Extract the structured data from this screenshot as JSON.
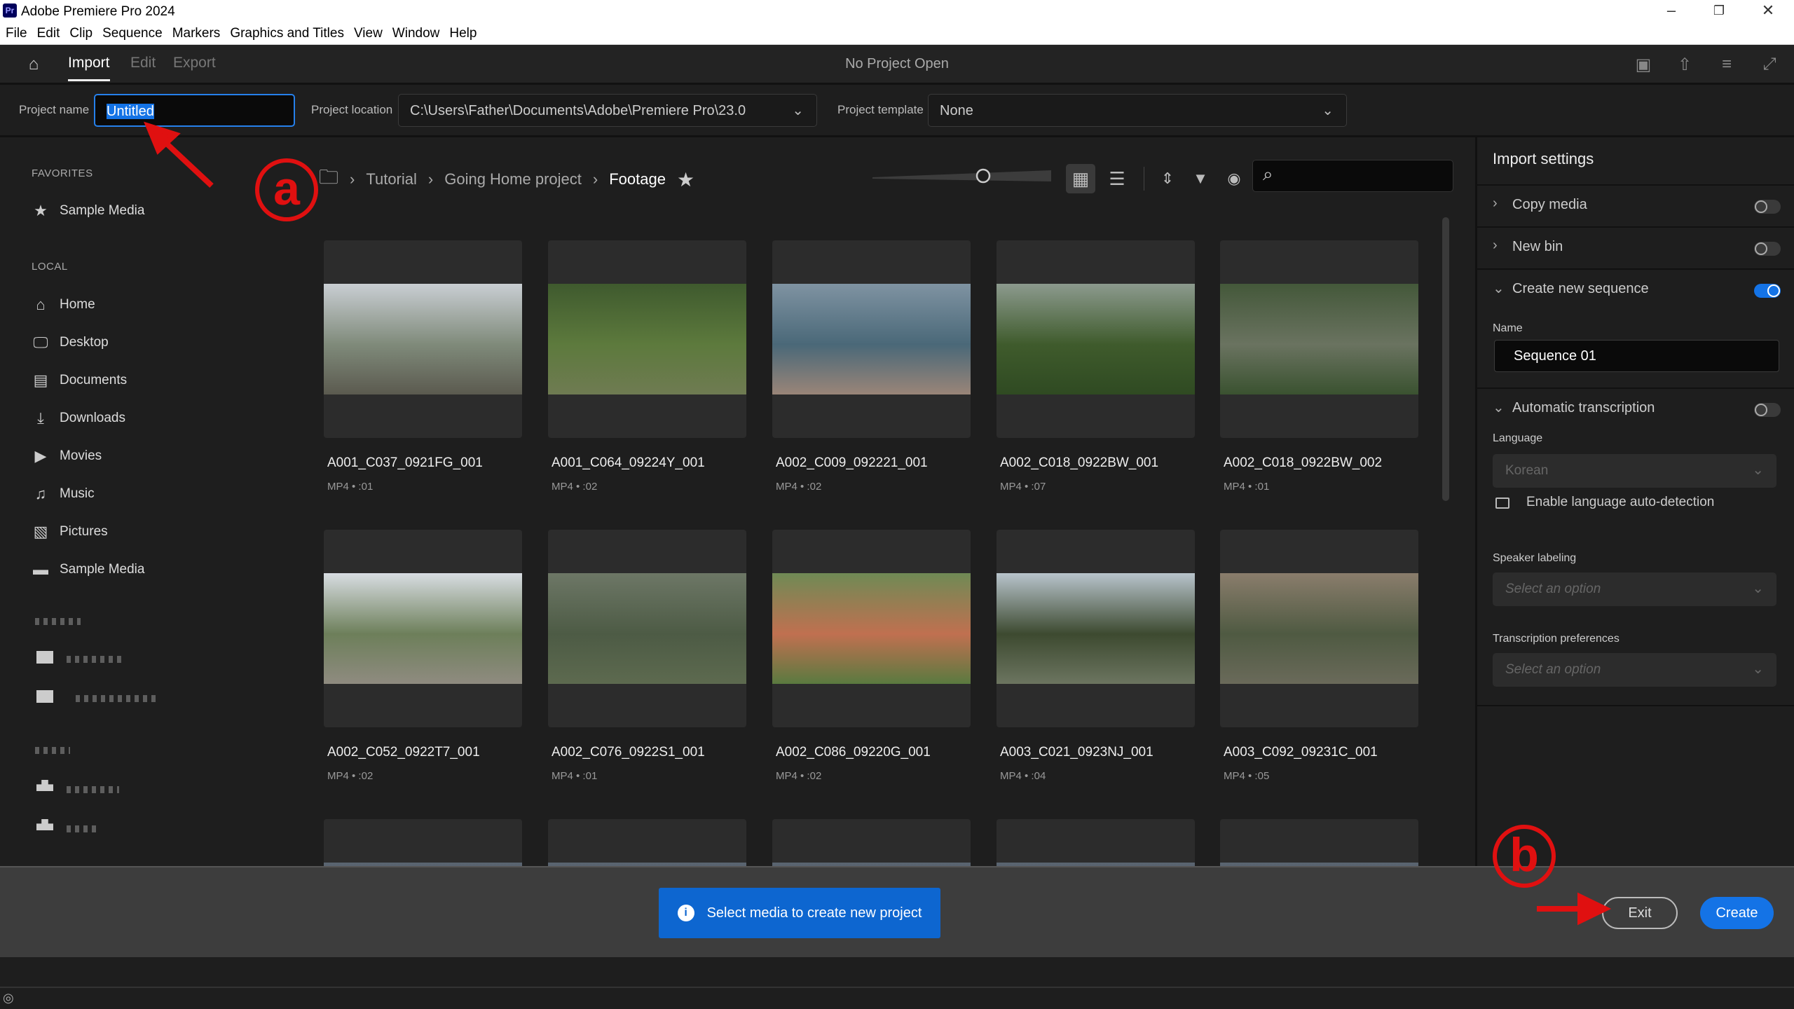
{
  "app": {
    "title": "Adobe Premiere Pro 2024",
    "logo": "Pr"
  },
  "menu": [
    "File",
    "Edit",
    "Clip",
    "Sequence",
    "Markers",
    "Graphics and Titles",
    "View",
    "Window",
    "Help"
  ],
  "nav": {
    "tabs": [
      "Import",
      "Edit",
      "Export"
    ],
    "active_tab": "Import",
    "status": "No Project Open"
  },
  "project": {
    "name_label": "Project name",
    "name_value": "Untitled",
    "location_label": "Project location",
    "location_value": "C:\\Users\\Father\\Documents\\Adobe\\Premiere Pro\\23.0",
    "template_label": "Project template",
    "template_value": "None"
  },
  "sidebar": {
    "favorites_label": "FAVORITES",
    "favorites": [
      {
        "label": "Sample Media",
        "icon": "star-icon"
      }
    ],
    "local_label": "LOCAL",
    "local": [
      {
        "label": "Home",
        "icon": "home-icon"
      },
      {
        "label": "Desktop",
        "icon": "desktop-icon"
      },
      {
        "label": "Documents",
        "icon": "document-icon"
      },
      {
        "label": "Downloads",
        "icon": "download-icon"
      },
      {
        "label": "Movies",
        "icon": "movie-icon"
      },
      {
        "label": "Music",
        "icon": "music-icon"
      },
      {
        "label": "Pictures",
        "icon": "picture-icon"
      },
      {
        "label": "Sample Media",
        "icon": "folder-icon"
      }
    ]
  },
  "breadcrumb": [
    "Tutorial",
    "Going Home project",
    "Footage"
  ],
  "clips": [
    {
      "name": "A001_C037_0921FG_001",
      "meta": "MP4 • :01",
      "colors": [
        "#c9ced3",
        "#7f8a7a",
        "#5b5a4f"
      ]
    },
    {
      "name": "A001_C064_09224Y_001",
      "meta": "MP4 • :02",
      "colors": [
        "#3f5a2e",
        "#5d7a3d",
        "#6f7b52"
      ]
    },
    {
      "name": "A002_C009_092221_001",
      "meta": "MP4 • :02",
      "colors": [
        "#7f93a2",
        "#4a6878",
        "#9a8578"
      ]
    },
    {
      "name": "A002_C018_0922BW_001",
      "meta": "MP4 • :07",
      "colors": [
        "#8c9a8e",
        "#3f5b2c",
        "#2f4a22"
      ]
    },
    {
      "name": "A002_C018_0922BW_002",
      "meta": "MP4 • :01",
      "colors": [
        "#44583a",
        "#6a7360",
        "#3a5230"
      ]
    },
    {
      "name": "A002_C052_0922T7_001",
      "meta": "MP4 • :02",
      "colors": [
        "#d8dde2",
        "#6d7f5a",
        "#8f8b80"
      ]
    },
    {
      "name": "A002_C076_0922S1_001",
      "meta": "MP4 • :01",
      "colors": [
        "#6d7766",
        "#4d5b45",
        "#5d6a4f"
      ]
    },
    {
      "name": "A002_C086_09220G_001",
      "meta": "MP4 • :02",
      "colors": [
        "#6f8a55",
        "#c07050",
        "#5a7a40"
      ]
    },
    {
      "name": "A003_C021_0923NJ_001",
      "meta": "MP4 • :04",
      "colors": [
        "#b8c4cc",
        "#3d4a30",
        "#6c7560"
      ]
    },
    {
      "name": "A003_C092_09231C_001",
      "meta": "MP4 • :05",
      "colors": [
        "#8a7d6c",
        "#4f5a42",
        "#6a6a5a"
      ]
    }
  ],
  "import_settings": {
    "title": "Import settings",
    "copy_media": {
      "label": "Copy media",
      "on": false
    },
    "new_bin": {
      "label": "New bin",
      "on": false
    },
    "create_sequence": {
      "label": "Create new sequence",
      "on": true,
      "name_label": "Name",
      "name_value": "Sequence 01"
    },
    "transcription": {
      "label": "Automatic transcription",
      "on": false,
      "language_label": "Language",
      "language_value": "Korean",
      "auto_detect_label": "Enable language auto-detection",
      "auto_detect_checked": false,
      "speaker_label": "Speaker labeling",
      "speaker_placeholder": "Select an option",
      "prefs_label": "Transcription preferences",
      "prefs_placeholder": "Select an option"
    }
  },
  "footer": {
    "message": "Select media to create new project",
    "exit_label": "Exit",
    "create_label": "Create"
  },
  "annotations": {
    "a": "a",
    "b": "b",
    "color": "#e01010"
  },
  "colors": {
    "accent": "#1473e6"
  }
}
